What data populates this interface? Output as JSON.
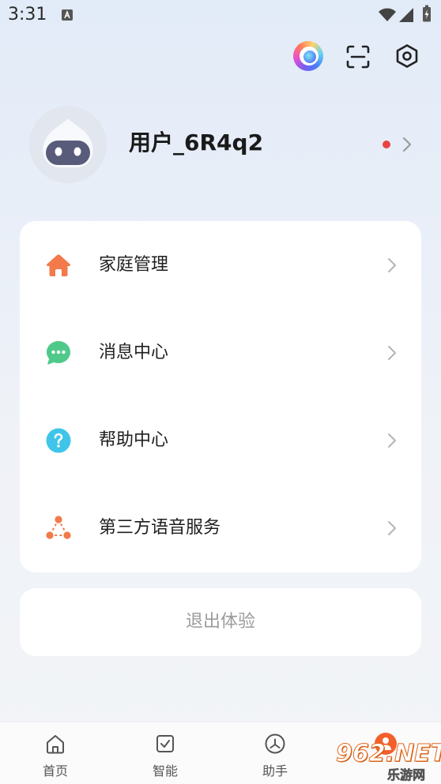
{
  "status_bar": {
    "time": "3:31",
    "icons": [
      "a-notification-icon",
      "wifi-icon",
      "signal-icon",
      "battery-charging-icon"
    ]
  },
  "header": {
    "icons": [
      "assistant-logo-icon",
      "scan-icon",
      "settings-icon"
    ]
  },
  "profile": {
    "name": "用户_6R4q2",
    "avatar": "robot-avatar",
    "has_notification_dot": true,
    "notification_dot_color": "#e94343"
  },
  "menu": {
    "items": [
      {
        "label": "家庭管理",
        "icon": "home-icon",
        "icon_color": "#f27a4b"
      },
      {
        "label": "消息中心",
        "icon": "message-icon",
        "icon_color": "#4fc98a"
      },
      {
        "label": "帮助中心",
        "icon": "help-icon",
        "icon_color": "#3ec5e9"
      },
      {
        "label": "第三方语音服务",
        "icon": "third-party-voice-icon",
        "icon_color": "#f27a4b"
      }
    ]
  },
  "logout": {
    "label": "退出体验"
  },
  "bottom_nav": {
    "items": [
      {
        "label": "首页",
        "icon": "home-outline-icon",
        "active": false
      },
      {
        "label": "智能",
        "icon": "smart-check-icon",
        "active": false
      },
      {
        "label": "助手",
        "icon": "assistant-icon",
        "active": false
      },
      {
        "icon": "profile-icon",
        "active": true,
        "icon_color": "#f3602c"
      }
    ]
  },
  "watermark": {
    "text": "962.NET",
    "subtext": "乐游网"
  },
  "colors": {
    "background_top": "#e2ebf8",
    "background_bottom": "#f2f4f7",
    "card": "#ffffff",
    "text_primary": "#1f1f1f",
    "text_secondary": "#9b9b9b"
  }
}
